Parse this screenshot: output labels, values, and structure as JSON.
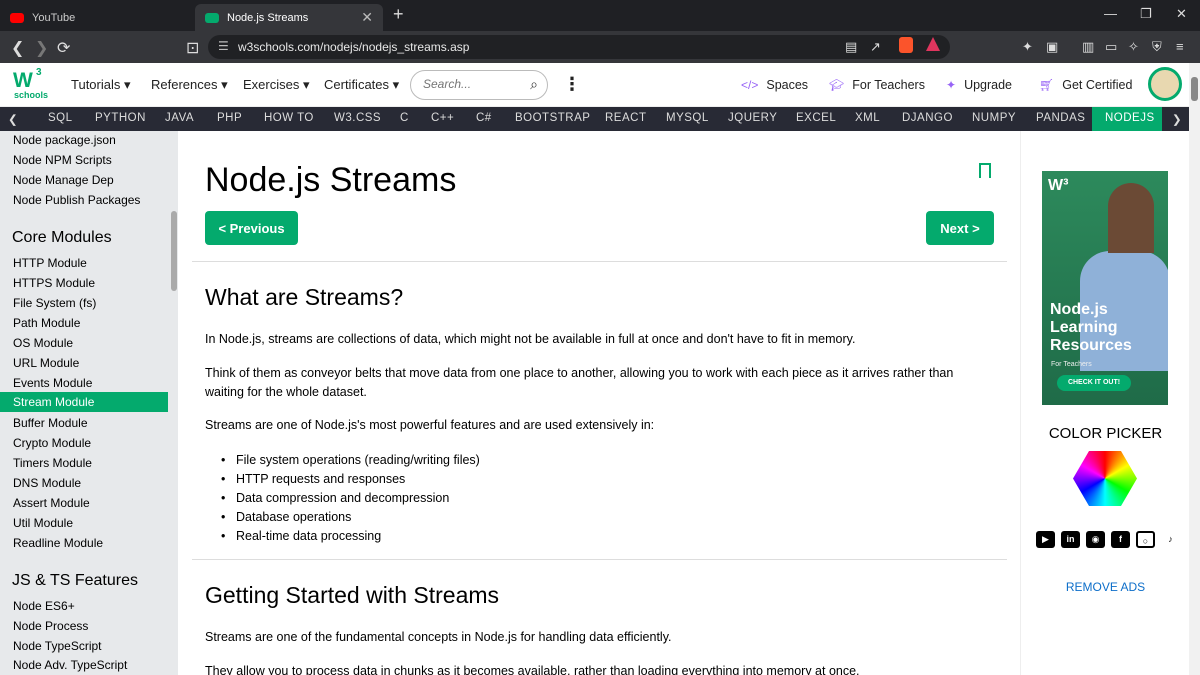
{
  "browser": {
    "tabs": [
      {
        "title": "YouTube",
        "active": false
      },
      {
        "title": "Node.js Streams",
        "active": true
      }
    ],
    "url": "w3schools.com/nodejs/nodejs_streams.asp"
  },
  "header": {
    "logo_main": "W",
    "logo_sup": "3",
    "logo_sub": "schools",
    "menu": [
      "Tutorials ▾",
      "References ▾",
      "Exercises ▾",
      "Certificates ▾"
    ],
    "search_placeholder": "Search...",
    "right_links": [
      "Spaces",
      "For Teachers",
      "Upgrade",
      "Get Certified"
    ]
  },
  "topnav": {
    "items": [
      "SQL",
      "PYTHON",
      "JAVA",
      "PHP",
      "HOW TO",
      "W3.CSS",
      "C",
      "C++",
      "C#",
      "BOOTSTRAP",
      "REACT",
      "MYSQL",
      "JQUERY",
      "EXCEL",
      "XML",
      "DJANGO",
      "NUMPY",
      "PANDAS"
    ],
    "active": "NODEJS"
  },
  "sidebar": {
    "top_items": [
      "Node package.json",
      "Node NPM Scripts",
      "Node Manage Dep",
      "Node Publish Packages"
    ],
    "section1": "Core Modules",
    "core_items": [
      "HTTP Module",
      "HTTPS Module",
      "File System (fs)",
      "Path Module",
      "OS Module",
      "URL Module",
      "Events Module",
      "Stream Module",
      "Buffer Module",
      "Crypto Module",
      "Timers Module",
      "DNS Module",
      "Assert Module",
      "Util Module",
      "Readline Module"
    ],
    "active_item": "Stream Module",
    "section2": "JS & TS Features",
    "js_items": [
      "Node ES6+",
      "Node Process",
      "Node TypeScript",
      "Node Adv. TypeScript"
    ]
  },
  "main": {
    "title": "Node.js Streams",
    "prev": "< Previous",
    "next": "Next >",
    "h2_1": "What are Streams?",
    "p1": "In Node.js, streams are collections of data, which might not be available in full at once and don't have to fit in memory.",
    "p2": "Think of them as conveyor belts that move data from one place to another, allowing you to work with each piece as it arrives rather than waiting for the whole dataset.",
    "p3": "Streams are one of Node.js's most powerful features and are used extensively in:",
    "bullets": [
      "File system operations (reading/writing files)",
      "HTTP requests and responses",
      "Data compression and decompression",
      "Database operations",
      "Real-time data processing"
    ],
    "h2_2": "Getting Started with Streams",
    "p4": "Streams are one of the fundamental concepts in Node.js for handling data efficiently.",
    "p5": "They allow you to process data in chunks as it becomes available, rather than loading everything into memory at once."
  },
  "rightcol": {
    "ad_logo": "W³",
    "ad_lines": [
      "Node.js",
      "Learning",
      "Resources"
    ],
    "ad_small": "For Teachers",
    "ad_button": "CHECK IT OUT!",
    "color_picker": "COLOR PICKER",
    "socials": [
      "youtube-icon",
      "linkedin-icon",
      "discord-icon",
      "facebook-icon",
      "instagram-icon",
      "tiktok-icon"
    ],
    "remove_ads": "REMOVE ADS"
  },
  "colors": {
    "accent": "#04aa6d",
    "topnav": "#282a35",
    "sidebar": "#e7e9eb",
    "link": "#0d6ec9"
  }
}
